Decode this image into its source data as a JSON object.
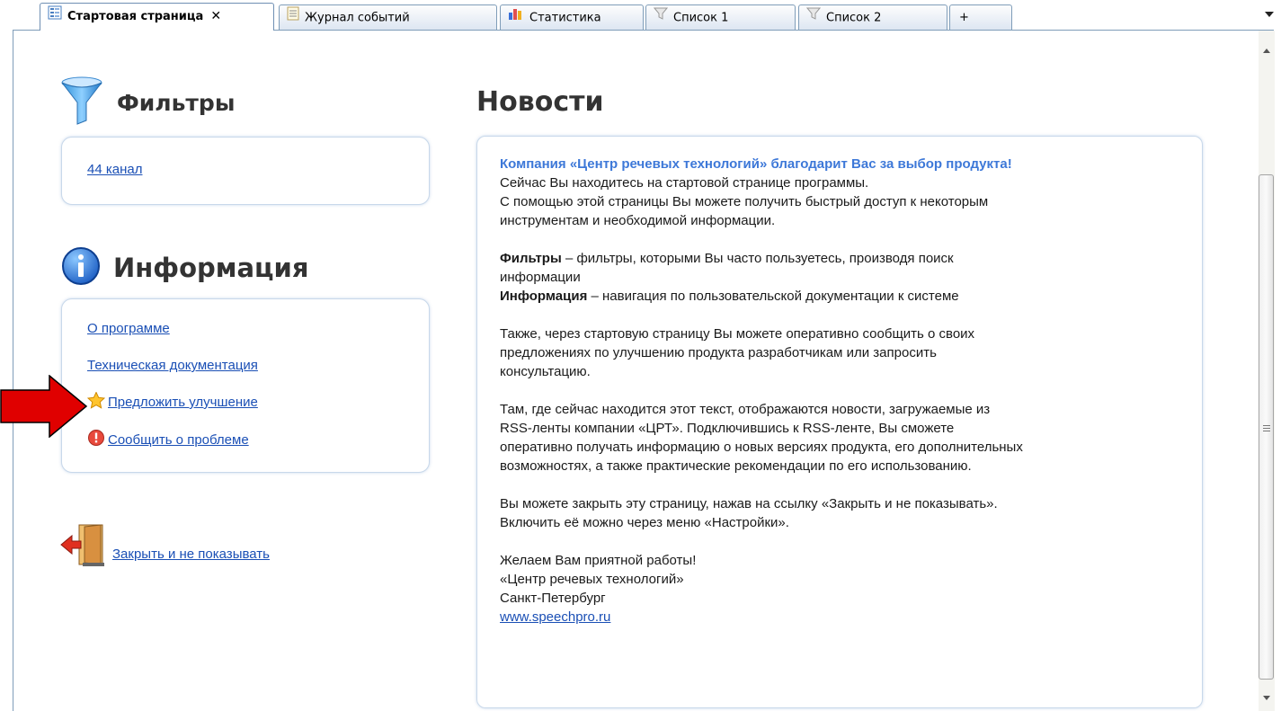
{
  "tabs": [
    {
      "label": "Стартовая страница",
      "icon": "start-page-icon",
      "active": true,
      "close": "✕"
    },
    {
      "label": "Журнал событий",
      "icon": "event-log-icon",
      "active": false
    },
    {
      "label": "Статистика",
      "icon": "bar-chart-icon",
      "active": false
    },
    {
      "label": "Список 1",
      "icon": "filter-icon",
      "active": false
    },
    {
      "label": "Список 2",
      "icon": "filter-icon",
      "active": false
    },
    {
      "label": "+",
      "icon": "",
      "active": false
    }
  ],
  "filters": {
    "title": "Фильтры",
    "items": [
      "44 канал"
    ]
  },
  "info": {
    "title": "Информация",
    "links": [
      {
        "label": "О программе",
        "icon": ""
      },
      {
        "label": "Техническая документация",
        "icon": ""
      },
      {
        "label": "Предложить улучшение",
        "icon": "star-icon"
      },
      {
        "label": "Сообщить о проблеме",
        "icon": "warning-icon"
      }
    ]
  },
  "close_link": {
    "label": "Закрыть и не показывать",
    "icon": "exit-door-icon"
  },
  "news": {
    "title": "Новости",
    "headline": "Компания «Центр речевых технологий» благодарит Вас за выбор продукта!",
    "intro_1": "Сейчас Вы находитесь на стартовой странице программы.",
    "intro_2": "С помощью этой страницы Вы можете получить быстрый доступ к некоторым",
    "intro_3": "инструментам и необходимой информации.",
    "filters_term": "Фильтры",
    "filters_desc_1": " – фильтры, которыми Вы часто пользуетесь, производя поиск",
    "filters_desc_2": "информации",
    "info_term": "Информация",
    "info_desc": " – навигация по пользовательской документации к системе",
    "p3_1": "Также, через стартовую страницу Вы можете оперативно сообщить о своих",
    "p3_2": "предложениях по улучшению продукта разработчикам или запросить",
    "p3_3": "консультацию.",
    "p4_1": "Там, где сейчас находится этот текст, отображаются новости, загружаемые из",
    "p4_2": "RSS-ленты компании «ЦРТ». Подключившись к RSS-ленте, Вы сможете",
    "p4_3": "оперативно получать информацию о новых версиях продукта, его дополнительных",
    "p4_4": "возможностях, а также практические рекомендации по его использованию.",
    "p5_1": "Вы можете закрыть эту страницу, нажав на ссылку «Закрыть и не показывать».",
    "p5_2": "Включить её можно через меню «Настройки».",
    "sign_1": "Желаем Вам приятной работы!",
    "sign_2": "«Центр речевых технологий»",
    "sign_3": "Санкт-Петербург",
    "website": "www.speechpro.ru"
  },
  "colors": {
    "link": "#1a4fb5",
    "headline": "#3d78d8",
    "arrow": "#e00000",
    "panel_border": "#c8d8ea"
  }
}
